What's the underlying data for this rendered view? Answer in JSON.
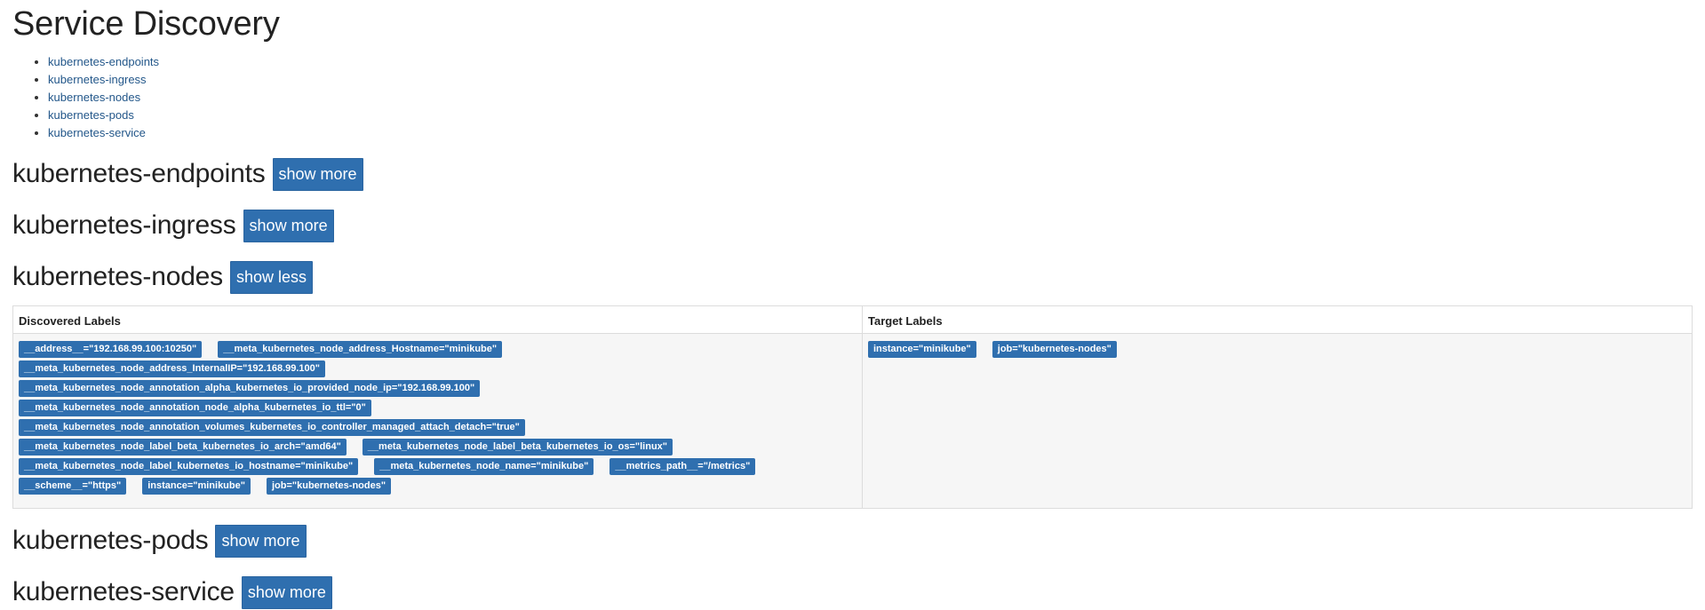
{
  "page": {
    "title": "Service Discovery"
  },
  "toc": [
    {
      "label": "kubernetes-endpoints"
    },
    {
      "label": "kubernetes-ingress"
    },
    {
      "label": "kubernetes-nodes"
    },
    {
      "label": "kubernetes-pods"
    },
    {
      "label": "kubernetes-service"
    }
  ],
  "sections": [
    {
      "name": "kubernetes-endpoints",
      "button": "show more"
    },
    {
      "name": "kubernetes-ingress",
      "button": "show more"
    },
    {
      "name": "kubernetes-nodes",
      "button": "show less"
    },
    {
      "name": "kubernetes-pods",
      "button": "show more"
    },
    {
      "name": "kubernetes-service",
      "button": "show more"
    }
  ],
  "table": {
    "headers": [
      "Discovered Labels",
      "Target Labels"
    ],
    "discovered_lines": [
      [
        "__address__=\"192.168.99.100:10250\"",
        "__meta_kubernetes_node_address_Hostname=\"minikube\""
      ],
      [
        "__meta_kubernetes_node_address_InternalIP=\"192.168.99.100\""
      ],
      [
        "__meta_kubernetes_node_annotation_alpha_kubernetes_io_provided_node_ip=\"192.168.99.100\""
      ],
      [
        "__meta_kubernetes_node_annotation_node_alpha_kubernetes_io_ttl=\"0\""
      ],
      [
        "__meta_kubernetes_node_annotation_volumes_kubernetes_io_controller_managed_attach_detach=\"true\""
      ],
      [
        "__meta_kubernetes_node_label_beta_kubernetes_io_arch=\"amd64\"",
        "__meta_kubernetes_node_label_beta_kubernetes_io_os=\"linux\""
      ],
      [
        "__meta_kubernetes_node_label_kubernetes_io_hostname=\"minikube\"",
        "__meta_kubernetes_node_name=\"minikube\"",
        "__metrics_path__=\"/metrics\""
      ],
      [
        "__scheme__=\"https\"",
        "instance=\"minikube\"",
        "job=\"kubernetes-nodes\""
      ]
    ],
    "target_labels": [
      "instance=\"minikube\"",
      "job=\"kubernetes-nodes\""
    ]
  },
  "colors": {
    "accent": "#2f6faf",
    "link": "#23578a",
    "table_bg": "#f6f6f6"
  }
}
